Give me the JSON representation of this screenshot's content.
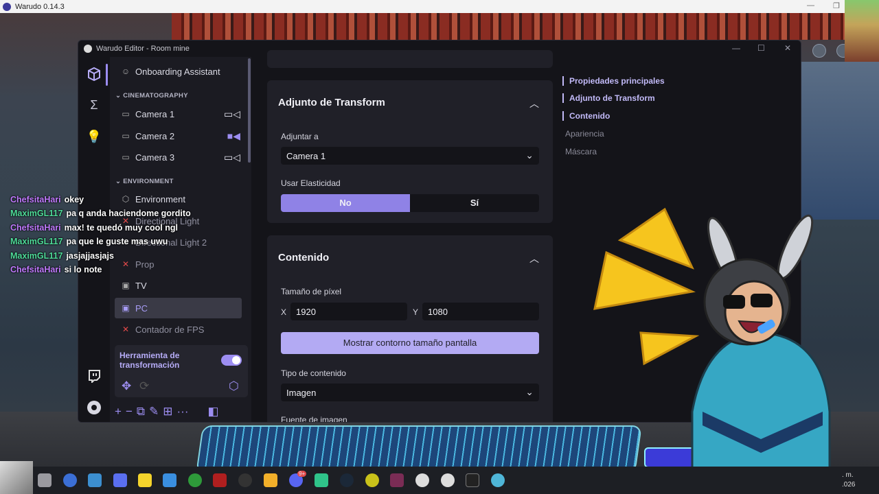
{
  "os": {
    "title": "Warudo 0.14.3"
  },
  "editor": {
    "title": "Warudo Editor - Room mine"
  },
  "sidebar": {
    "top_item": "Onboarding Assistant",
    "sections": {
      "cinematography": "CINEMATOGRAPHY",
      "environment": "ENVIRONMENT"
    },
    "cameras": [
      "Camera 1",
      "Camera 2",
      "Camera 3"
    ],
    "items": [
      "Environment",
      "Directional Light",
      "Directional Light 2",
      "Prop",
      "TV",
      "PC",
      "Contador de FPS"
    ]
  },
  "tool_panel": {
    "label": "Herramienta de transformación",
    "toggle_on": true
  },
  "transform": {
    "header": "Adjunto de Transform",
    "attach_label": "Adjuntar a",
    "attach_value": "Camera 1",
    "elasticity_label": "Usar Elasticidad",
    "elasticity_no": "No",
    "elasticity_yes": "Sí",
    "elasticity_selected": "No"
  },
  "content": {
    "header": "Contenido",
    "pixel_size_label": "Tamaño de píxel",
    "x_label": "X",
    "x_value": "1920",
    "y_label": "Y",
    "y_value": "1080",
    "outline_button": "Mostrar contorno tamaño pantalla",
    "content_type_label": "Tipo de contenido",
    "content_type_value": "Imagen",
    "image_source_label": "Fuente de imagen"
  },
  "right_nav": {
    "items": [
      "Propiedades principales",
      "Adjunto de Transform",
      "Contenido",
      "Apariencia",
      "Máscara"
    ],
    "active_count": 3
  },
  "chat": [
    {
      "user": "ChefsitaHari",
      "msg": "okey",
      "color": "#c17bff"
    },
    {
      "user": "MaximGL117",
      "msg": "pa q anda haciendome gordito",
      "color": "#4fdc9a"
    },
    {
      "user": "ChefsitaHari",
      "msg": "max! te quedó muy cool ngl",
      "color": "#c17bff"
    },
    {
      "user": "MaximGL117",
      "msg": "pa que le guste mas uwu",
      "color": "#4fdc9a"
    },
    {
      "user": "MaximGL117",
      "msg": "jasjajjasjajs",
      "color": "#4fdc9a"
    },
    {
      "user": "ChefsitaHari",
      "msg": "si lo note",
      "color": "#c17bff"
    }
  ],
  "taskbar": {
    "clock_line1": ". m.",
    "clock_line2": ".026",
    "badge": "9+"
  },
  "colors": {
    "accent": "#8f82e6",
    "accent_light": "#b3aaf3"
  }
}
